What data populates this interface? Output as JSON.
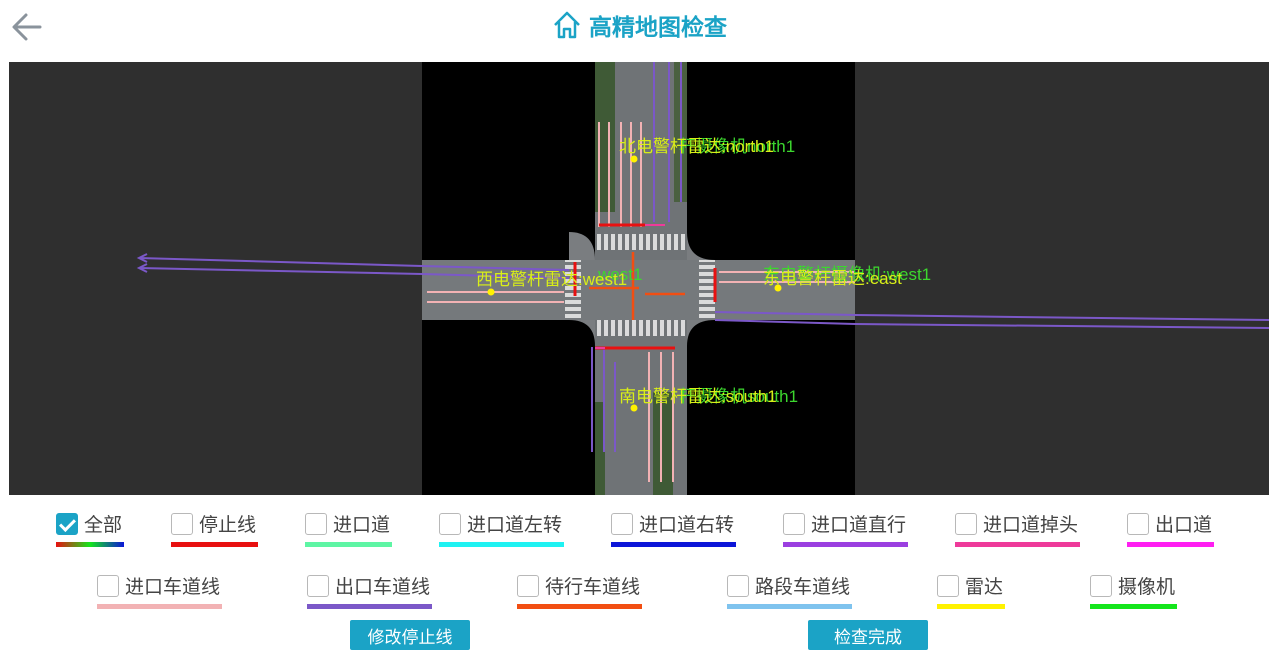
{
  "header": {
    "title": "高精地图检查",
    "back_icon": "arrow-left-icon",
    "home_icon": "home-icon"
  },
  "map": {
    "radars": [
      {
        "name": "北电警杆雷达:north1",
        "alt": "杆摄像机north1"
      },
      {
        "name": "西电警杆雷达:west1",
        "alt": "west1"
      },
      {
        "name": "东电警杆雷达:east",
        "alt": "东电警杆摄像机:west1"
      },
      {
        "name": "南电警杆雷达:south1",
        "alt": "杆摄像机south1"
      }
    ]
  },
  "legend": {
    "items": [
      {
        "label": "全部",
        "checked": true,
        "color": "gradient"
      },
      {
        "label": "停止线",
        "checked": false,
        "color": "#e81010"
      },
      {
        "label": "进口道",
        "checked": false,
        "color": "#5ef5a4"
      },
      {
        "label": "进口道左转",
        "checked": false,
        "color": "#1ff2f2"
      },
      {
        "label": "进口道右转",
        "checked": false,
        "color": "#0c15d8"
      },
      {
        "label": "进口道直行",
        "checked": false,
        "color": "#9b3fe0"
      },
      {
        "label": "进口道掉头",
        "checked": false,
        "color": "#ee3a9a"
      },
      {
        "label": "出口道",
        "checked": false,
        "color": "#ff1ef2"
      },
      {
        "label": "进口车道线",
        "checked": false,
        "color": "#f2b2b4"
      },
      {
        "label": "出口车道线",
        "checked": false,
        "color": "#7b58c8"
      },
      {
        "label": "待行车道线",
        "checked": false,
        "color": "#f24e12"
      },
      {
        "label": "路段车道线",
        "checked": false,
        "color": "#7fc3ee"
      },
      {
        "label": "雷达",
        "checked": false,
        "color": "#fff200"
      },
      {
        "label": "摄像机",
        "checked": false,
        "color": "#14e61c"
      }
    ]
  },
  "buttons": {
    "modify_stopline": "修改停止线",
    "check_done": "检查完成"
  }
}
